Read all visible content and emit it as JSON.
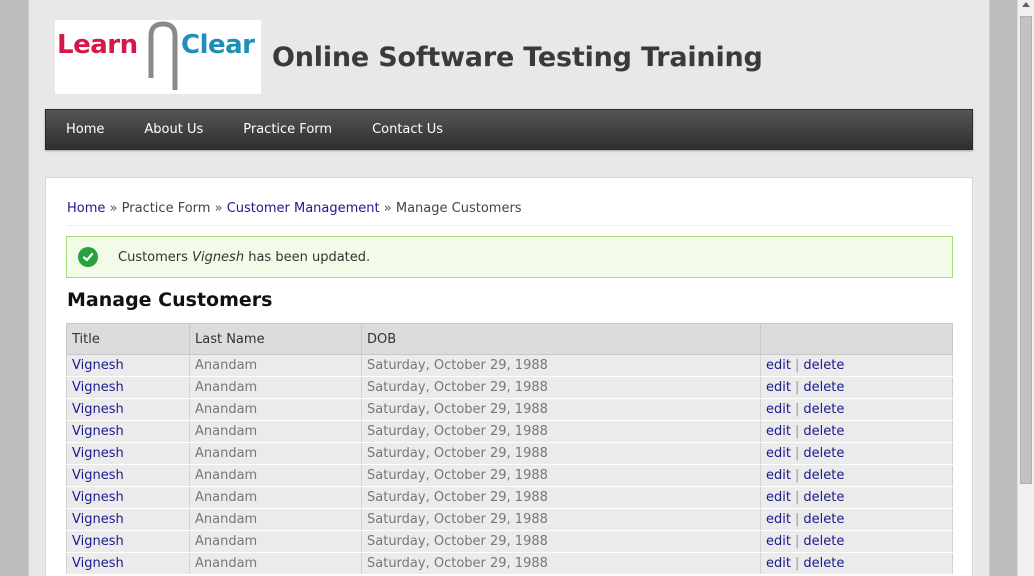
{
  "logo": {
    "learn": "Learn",
    "clear": "Clear"
  },
  "site_title": "Online Software Testing Training",
  "nav": [
    {
      "label": "Home"
    },
    {
      "label": "About Us"
    },
    {
      "label": "Practice Form"
    },
    {
      "label": "Contact Us"
    }
  ],
  "breadcrumb": {
    "home": "Home",
    "practice_form": "Practice Form",
    "customer_management": "Customer Management",
    "current": "Manage Customers",
    "separator": "»"
  },
  "alert": {
    "prefix": "Customers",
    "name": "Vignesh",
    "suffix": "has been updated.",
    "icon": "check-circle-icon"
  },
  "page_heading": "Manage Customers",
  "table": {
    "headers": [
      "Title",
      "Last Name",
      "DOB",
      ""
    ],
    "rows": [
      {
        "title": "Vignesh",
        "last_name": "Anandam",
        "dob": "Saturday, October 29, 1988",
        "edit": "edit",
        "delete": "delete"
      },
      {
        "title": "Vignesh",
        "last_name": "Anandam",
        "dob": "Saturday, October 29, 1988",
        "edit": "edit",
        "delete": "delete"
      },
      {
        "title": "Vignesh",
        "last_name": "Anandam",
        "dob": "Saturday, October 29, 1988",
        "edit": "edit",
        "delete": "delete"
      },
      {
        "title": "Vignesh",
        "last_name": "Anandam",
        "dob": "Saturday, October 29, 1988",
        "edit": "edit",
        "delete": "delete"
      },
      {
        "title": "Vignesh",
        "last_name": "Anandam",
        "dob": "Saturday, October 29, 1988",
        "edit": "edit",
        "delete": "delete"
      },
      {
        "title": "Vignesh",
        "last_name": "Anandam",
        "dob": "Saturday, October 29, 1988",
        "edit": "edit",
        "delete": "delete"
      },
      {
        "title": "Vignesh",
        "last_name": "Anandam",
        "dob": "Saturday, October 29, 1988",
        "edit": "edit",
        "delete": "delete"
      },
      {
        "title": "Vignesh",
        "last_name": "Anandam",
        "dob": "Saturday, October 29, 1988",
        "edit": "edit",
        "delete": "delete"
      },
      {
        "title": "Vignesh",
        "last_name": "Anandam",
        "dob": "Saturday, October 29, 1988",
        "edit": "edit",
        "delete": "delete"
      },
      {
        "title": "Vignesh",
        "last_name": "Anandam",
        "dob": "Saturday, October 29, 1988",
        "edit": "edit",
        "delete": "delete"
      }
    ]
  },
  "colors": {
    "brand_red": "#d6174a",
    "brand_blue": "#1e8fb8",
    "success_green": "#27a33e",
    "link": "#1a1a8c"
  }
}
